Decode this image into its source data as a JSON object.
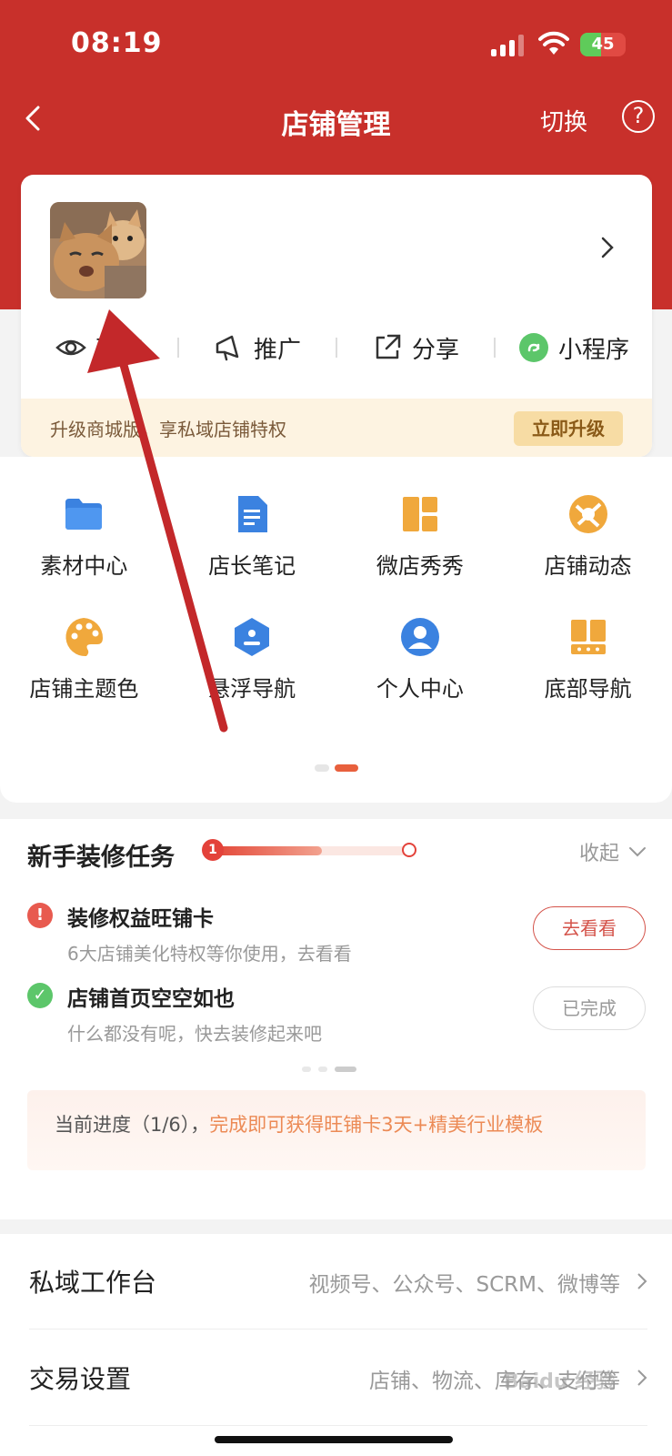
{
  "status_bar": {
    "time": "08:19",
    "battery": "45",
    "battery_level": 0.45
  },
  "navbar": {
    "title": "店铺管理",
    "switch_label": "切换",
    "help_label": "?"
  },
  "store_card": {
    "actions": [
      {
        "label": "预览",
        "icon": "eye-icon"
      },
      {
        "label": "推广",
        "icon": "megaphone-icon"
      },
      {
        "label": "分享",
        "icon": "share-icon"
      },
      {
        "label": "小程序",
        "icon": "mini-program-icon"
      }
    ],
    "upgrade": {
      "text": "升级商城版，享私域店铺特权",
      "button": "立即升级"
    }
  },
  "grid": {
    "items": [
      {
        "label": "素材中心",
        "icon": "folder-icon"
      },
      {
        "label": "店长笔记",
        "icon": "note-icon"
      },
      {
        "label": "微店秀秀",
        "icon": "layout-icon"
      },
      {
        "label": "店铺动态",
        "icon": "aperture-icon"
      },
      {
        "label": "店铺主题色",
        "icon": "palette-icon"
      },
      {
        "label": "悬浮导航",
        "icon": "hexagon-icon"
      },
      {
        "label": "个人中心",
        "icon": "user-icon"
      },
      {
        "label": "底部导航",
        "icon": "bottom-nav-icon"
      }
    ]
  },
  "tasks": {
    "title": "新手装修任务",
    "progress_start": "1",
    "progress_fraction": 0.56,
    "collapse_label": "收起",
    "items": [
      {
        "name": "装修权益旺铺卡",
        "desc": "6大店铺美化特权等你使用，去看看",
        "button": "去看看",
        "status": "pending"
      },
      {
        "name": "店铺首页空空如也",
        "desc": "什么都没有呢，快去装修起来吧",
        "button": "已完成",
        "status": "done"
      }
    ],
    "note_prefix": "当前进度（1/6），",
    "note_highlight": "完成即可获得旺铺卡3天+精美行业模板"
  },
  "list": {
    "rows": [
      {
        "label": "私域工作台",
        "value": "视频号、公众号、SCRM、微博等"
      },
      {
        "label": "交易设置",
        "value": "店铺、物流、库存、支付等"
      }
    ]
  },
  "watermark": "Baidu 经验",
  "colors": {
    "brand_red": "#c8302b",
    "accent_orange": "#e8603d",
    "success_green": "#5cc66a",
    "warning_red": "#e85a4f",
    "icon_blue": "#3b82e0",
    "icon_orange": "#f0a83c"
  }
}
